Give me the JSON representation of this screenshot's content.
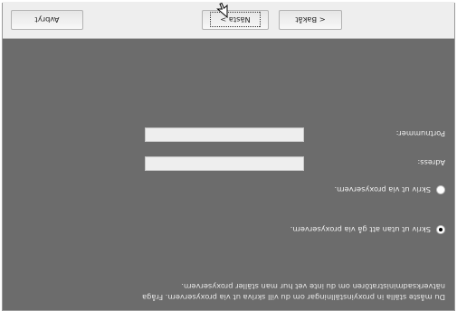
{
  "description": {
    "lines": [
      "Du måste ställa in proxyinställningar om du vill skriva ut via proxyservern. Fråga",
      "nätverksadministratören om du inte vet hur man ställer proxyservern."
    ]
  },
  "options": [
    {
      "label": "Skriv ut utan att gå via proxyservern.",
      "selected": true
    },
    {
      "label": "Skriv ut via proxyservern.",
      "selected": false
    }
  ],
  "fields": {
    "address": {
      "label": "Adress:",
      "value": ""
    },
    "port": {
      "label": "Portnummer:",
      "value": ""
    }
  },
  "buttons": {
    "back": "< Bakåt",
    "next": "Nästa >",
    "cancel": "Avbryt"
  }
}
